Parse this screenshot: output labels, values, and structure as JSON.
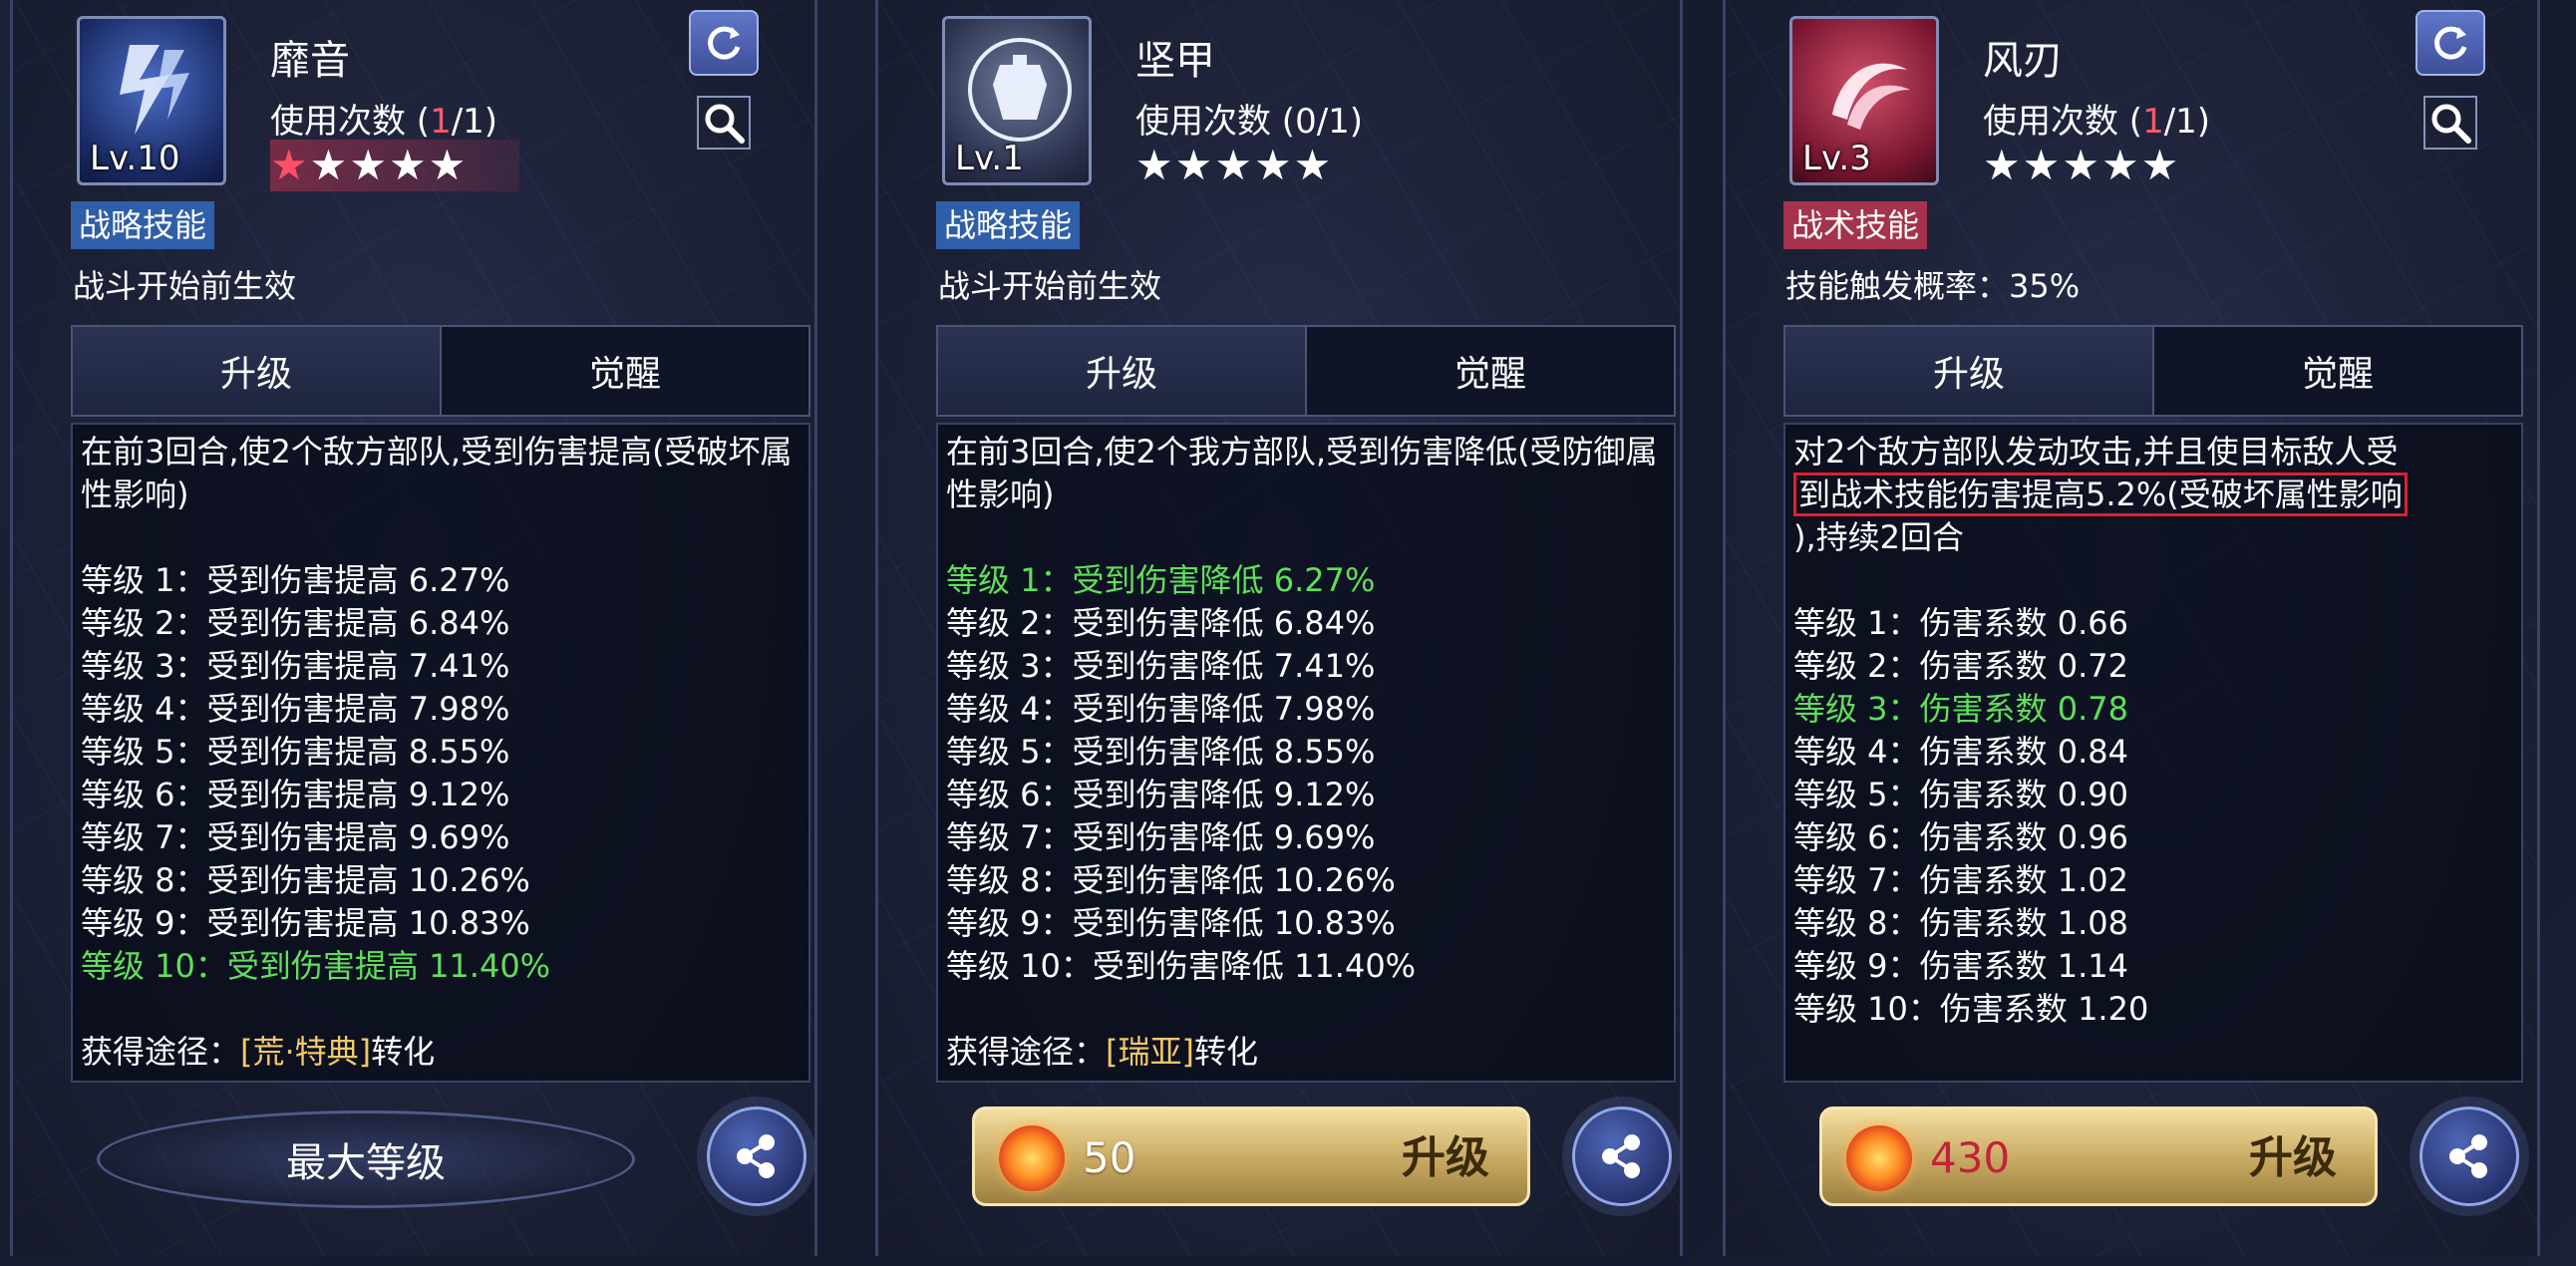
{
  "panels": [
    {
      "skill_name": "靡音",
      "level": "Lv.10",
      "usage_label": "使用次数",
      "usage_open": " (",
      "usage_used": "1",
      "usage_rest": "/1)",
      "stars_filled": 1,
      "stars_total": 5,
      "tag": "战略技能",
      "effect": "战斗开始前生效",
      "tab_upgrade": "升级",
      "tab_awaken": "觉醒",
      "description": "在前3回合,使2个敌方部队,受到伤害提高(受破坏属性影响)",
      "levels": [
        "等级 1：受到伤害提高 6.27%",
        "等级 2：受到伤害提高 6.84%",
        "等级 3：受到伤害提高 7.41%",
        "等级 4：受到伤害提高 7.98%",
        "等级 5：受到伤害提高 8.55%",
        "等级 6：受到伤害提高 9.12%",
        "等级 7：受到伤害提高 9.69%",
        "等级 8：受到伤害提高 10.26%",
        "等级 9：受到伤害提高 10.83%",
        "等级 10：受到伤害提高 11.40%"
      ],
      "current_level_index": 9,
      "source_label": "获得途径：",
      "source_name": "[荒·特典]",
      "source_suffix": "转化",
      "action_label": "最大等级"
    },
    {
      "skill_name": "坚甲",
      "level": "Lv.1",
      "usage_label": "使用次数",
      "usage_full": " (0/1)",
      "stars_filled": 0,
      "stars_total": 5,
      "tag": "战略技能",
      "effect": "战斗开始前生效",
      "tab_upgrade": "升级",
      "tab_awaken": "觉醒",
      "description": "在前3回合,使2个我方部队,受到伤害降低(受防御属性影响)",
      "levels": [
        "等级 1：受到伤害降低 6.27%",
        "等级 2：受到伤害降低 6.84%",
        "等级 3：受到伤害降低 7.41%",
        "等级 4：受到伤害降低 7.98%",
        "等级 5：受到伤害降低 8.55%",
        "等级 6：受到伤害降低 9.12%",
        "等级 7：受到伤害降低 9.69%",
        "等级 8：受到伤害降低 10.26%",
        "等级 9：受到伤害降低 10.83%",
        "等级 10：受到伤害降低 11.40%"
      ],
      "current_level_index": 0,
      "source_label": "获得途径：",
      "source_name": "[瑞亚]",
      "source_suffix": "转化",
      "cost": "50",
      "action_label": "升级"
    },
    {
      "skill_name": "风刃",
      "level": "Lv.3",
      "usage_label": "使用次数",
      "usage_open": " (",
      "usage_used": "1",
      "usage_rest": "/1)",
      "stars_filled": 0,
      "stars_total": 5,
      "tag": "战术技能",
      "effect": "技能触发概率：35%",
      "tab_upgrade": "升级",
      "tab_awaken": "觉醒",
      "description_a": "对2个敌方部队发动攻击,并且使目标敌人受",
      "description_highlight": "到战术技能伤害提高5.2%(受破坏属性影响",
      "description_b": "),持续2回合",
      "levels": [
        "等级 1：伤害系数 0.66",
        "等级 2：伤害系数 0.72",
        "等级 3：伤害系数 0.78",
        "等级 4：伤害系数 0.84",
        "等级 5：伤害系数 0.90",
        "等级 6：伤害系数 0.96",
        "等级 7：伤害系数 1.02",
        "等级 8：伤害系数 1.08",
        "等级 9：伤害系数 1.14",
        "等级 10：伤害系数 1.20"
      ],
      "current_level_index": 2,
      "cost": "430",
      "action_label": "升级"
    }
  ],
  "colors": {
    "current_level": "#5fe05a",
    "star_filled": "#ff4f66",
    "source_bracket": "#f2c86a",
    "highlight_border": "#e0202c"
  },
  "icons": [
    "refresh-icon",
    "search-icon",
    "share-icon",
    "coin-icon",
    "skill-icon"
  ]
}
